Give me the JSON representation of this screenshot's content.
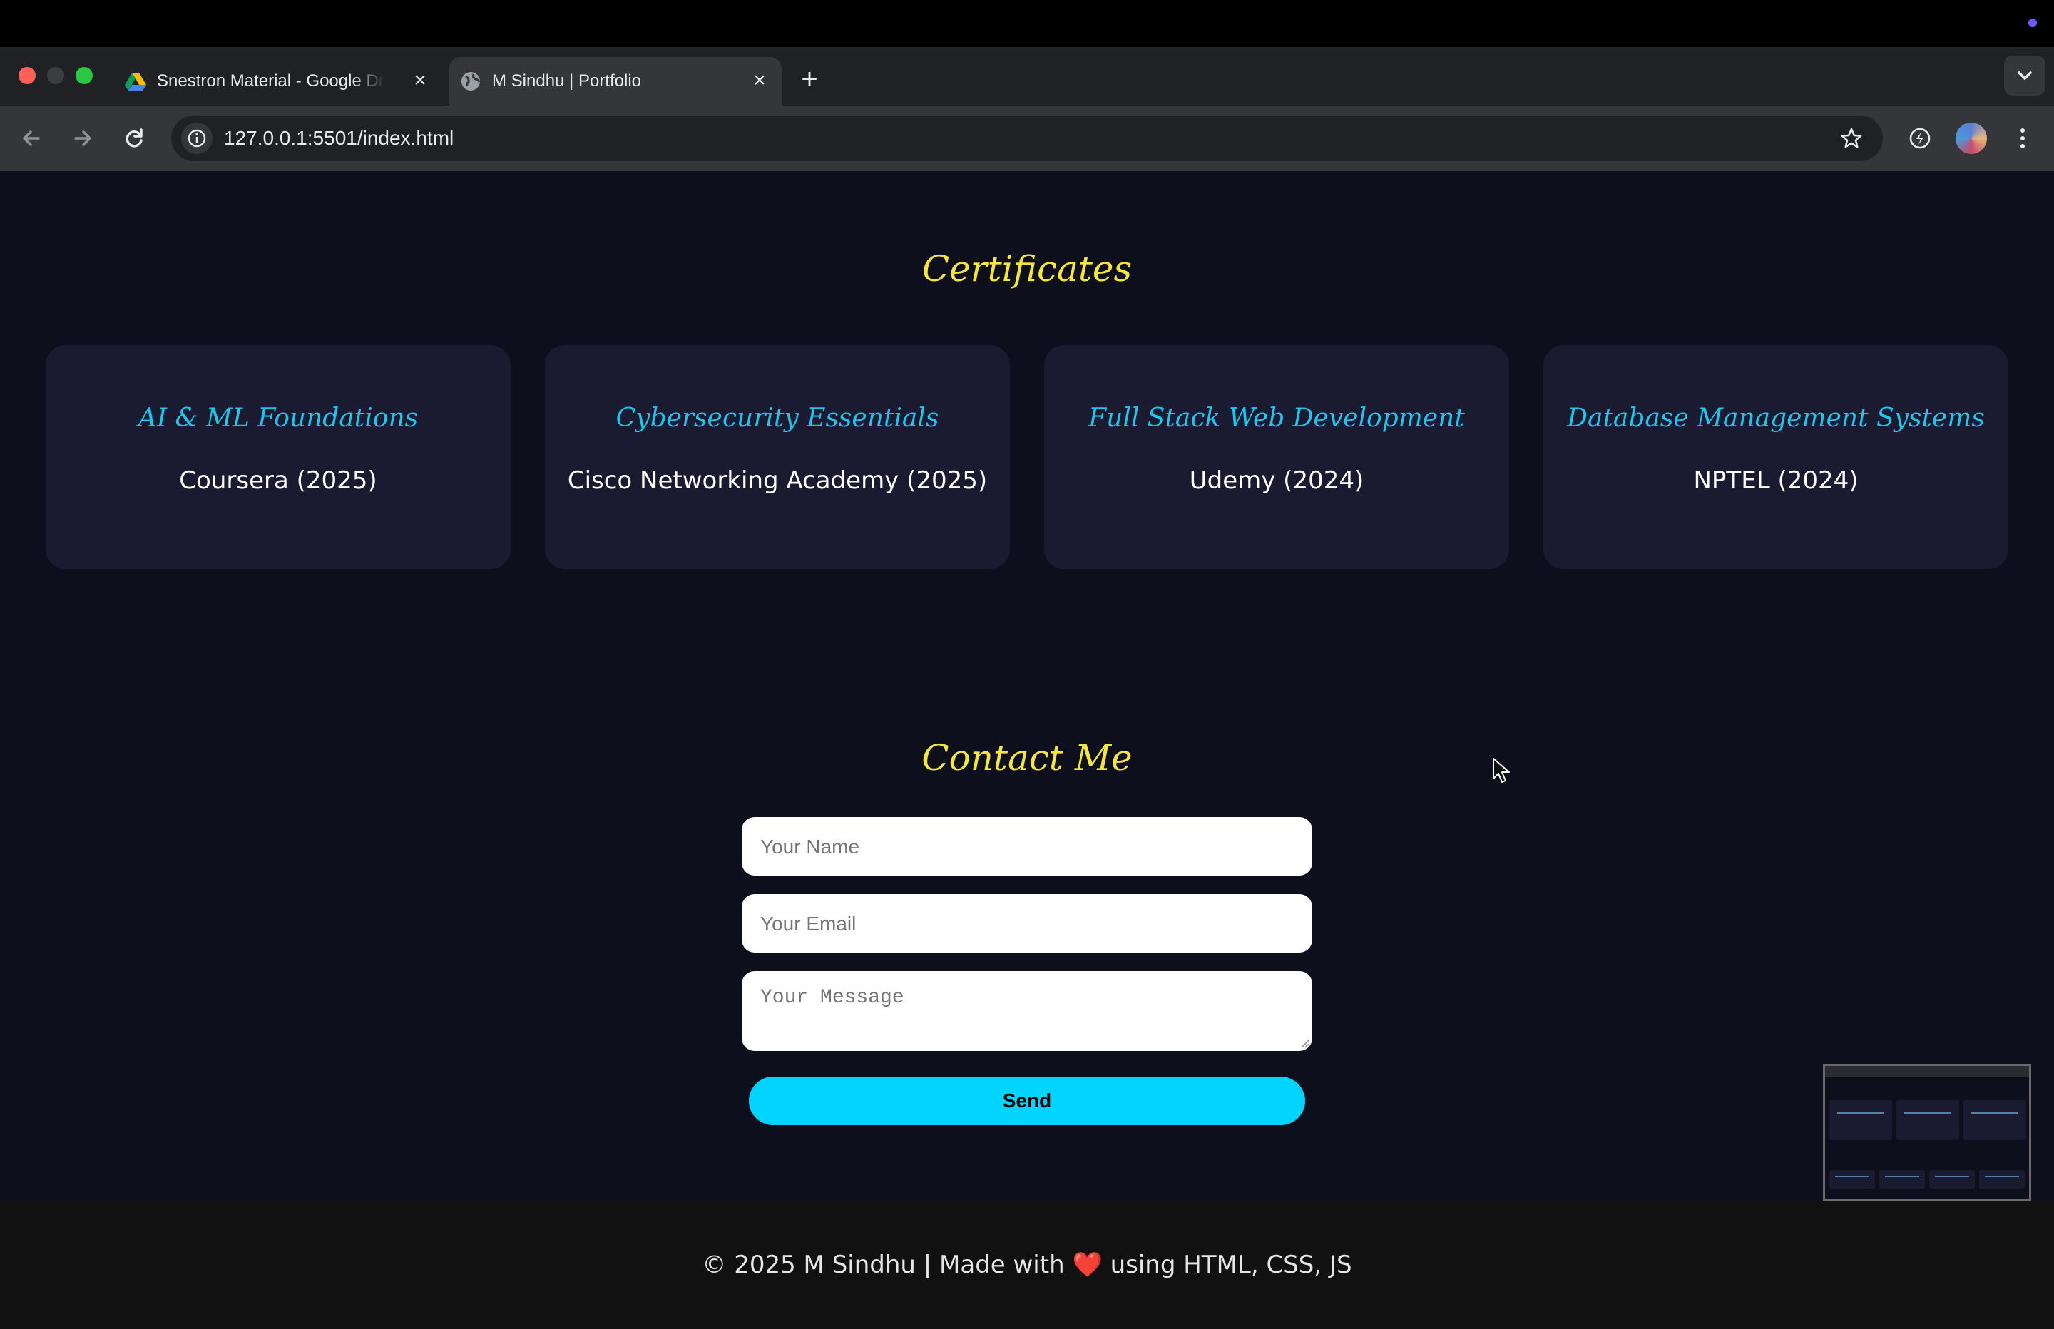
{
  "browser": {
    "tabs": [
      {
        "title": "Snestron Material - Google Drive",
        "active": false,
        "icon": "google-drive-icon"
      },
      {
        "title": "M Sindhu | Portfolio",
        "active": true,
        "icon": "globe-icon"
      }
    ],
    "url": "127.0.0.1:5501/index.html"
  },
  "certificates": {
    "heading": "Certificates",
    "items": [
      {
        "title": "AI & ML Foundations",
        "org": "Coursera (2025)"
      },
      {
        "title": "Cybersecurity Essentials",
        "org": "Cisco Networking Academy (2025)"
      },
      {
        "title": "Full Stack Web Development",
        "org": "Udemy (2024)"
      },
      {
        "title": "Database Management Systems",
        "org": "NPTEL (2024)"
      }
    ]
  },
  "contact": {
    "heading": "Contact Me",
    "name_placeholder": "Your Name",
    "email_placeholder": "Your Email",
    "message_placeholder": "Your Message",
    "send_label": "Send"
  },
  "footer": {
    "before": "© 2025 M Sindhu | Made with ",
    "heart": "❤️",
    "after": " using HTML, CSS, JS"
  },
  "colors": {
    "heading": "#f5e63b",
    "accent": "#1dc6ee",
    "button": "#00d4ff",
    "card": "#1a1b31",
    "page_bg": "#0e0f1d"
  }
}
